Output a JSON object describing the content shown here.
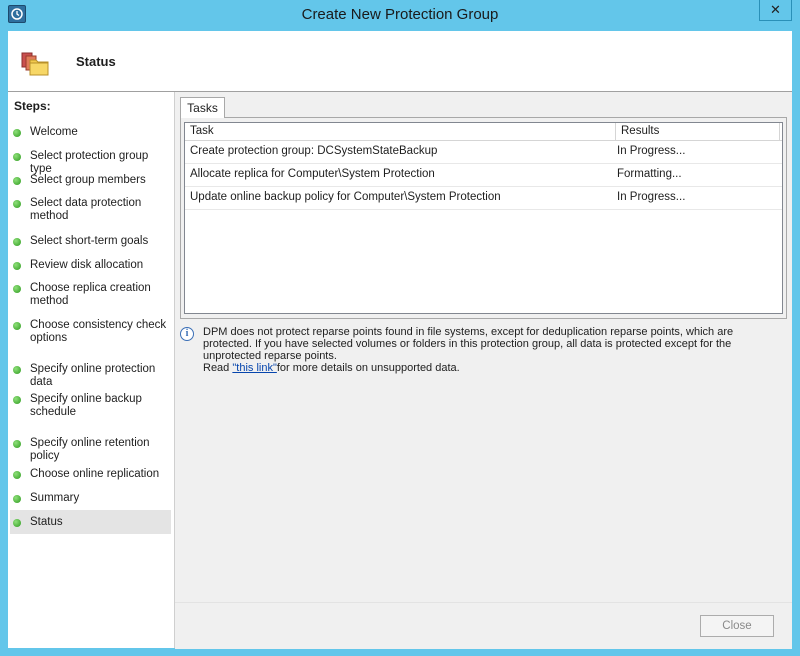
{
  "window": {
    "title": "Create New Protection Group",
    "close_glyph": "✕"
  },
  "header": {
    "title": "Status",
    "icon": "folders-icon"
  },
  "steps": {
    "label": "Steps:",
    "items": [
      {
        "label": "Welcome"
      },
      {
        "label": "Select protection group type"
      },
      {
        "label": "Select group members"
      },
      {
        "label": "Select data protection method"
      },
      {
        "label": "Select short-term goals"
      },
      {
        "label": "Review disk allocation"
      },
      {
        "label": "Choose replica creation method"
      },
      {
        "label": "Choose consistency check options"
      },
      {
        "label": "Specify online protection data"
      },
      {
        "label": "Specify online backup schedule"
      },
      {
        "label": "Specify online retention policy"
      },
      {
        "label": "Choose online replication"
      },
      {
        "label": "Summary"
      },
      {
        "label": "Status"
      }
    ],
    "active": "Status"
  },
  "tasks_tab": {
    "label": "Tasks",
    "columns": {
      "task": "Task",
      "results": "Results"
    },
    "rows": [
      {
        "task": "Create protection group: DCSystemStateBackup",
        "result": "In Progress..."
      },
      {
        "task": "Allocate replica for Computer\\System Protection",
        "result": "Formatting..."
      },
      {
        "task": "Update online backup policy for Computer\\System Protection",
        "result": "In Progress..."
      }
    ]
  },
  "info": {
    "text": "DPM does not protect reparse points found in file systems, except for deduplication reparse points, which are protected. If you have selected volumes or folders in this protection group, all data is protected except for the unprotected reparse points.",
    "read_prefix": "Read ",
    "link_text": "\"this link\"",
    "read_suffix": "for more details on unsupported data."
  },
  "footer": {
    "close_label": "Close"
  },
  "colors": {
    "titlebar": "#63c6ea",
    "step_dot": "#2d9a1e",
    "link": "#0645ad"
  }
}
